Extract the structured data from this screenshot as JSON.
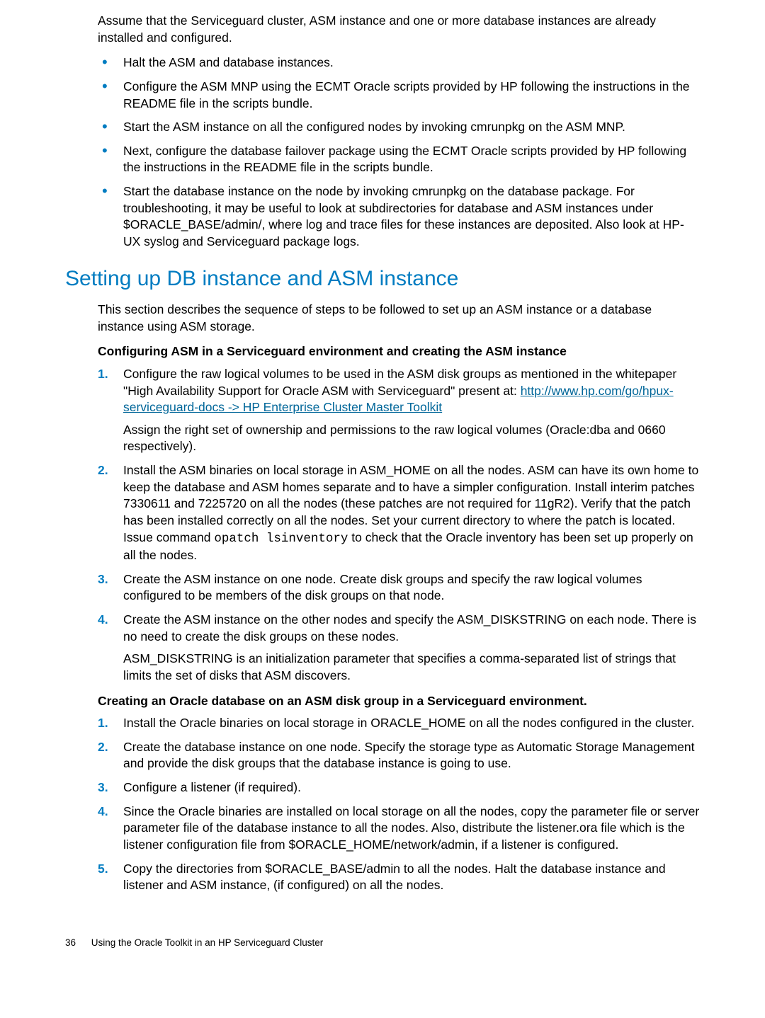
{
  "intro": "Assume that the Serviceguard cluster, ASM instance and one or more database instances are already installed and configured.",
  "bullets": [
    "Halt the ASM and database instances.",
    "Configure the ASM MNP using the ECMT Oracle scripts provided by HP following the instructions in the README file in the scripts bundle.",
    "Start the ASM instance on all the configured nodes by invoking cmrunpkg on the ASM MNP.",
    "Next, configure the database failover package using the ECMT Oracle scripts provided by HP following the instructions in the README file in the scripts bundle.",
    "Start the database instance on the node by invoking cmrunpkg on the database package. For troubleshooting, it may be useful to look at subdirectories for database and ASM instances under $ORACLE_BASE/admin/, where log and trace files for these instances are deposited. Also look at HP-UX syslog and Serviceguard package logs."
  ],
  "section_title": "Setting up DB instance and ASM instance",
  "section_intro": "This section describes the sequence of steps to be followed to set up an ASM instance or a database instance using ASM storage.",
  "sub1_title": "Configuring ASM in a Serviceguard environment and creating the ASM instance",
  "sub1_steps": {
    "s1_pre": "Configure the raw logical volumes to be used in the ASM disk groups as mentioned in the whitepaper \"High Availability Support for Oracle ASM with Serviceguard\" present at: ",
    "s1_link": "http://www.hp.com/go/hpux-serviceguard-docs -> HP Enterprise Cluster Master Toolkit",
    "s1_after": "Assign the right set of ownership and permissions to the raw logical volumes (Oracle:dba and 0660 respectively).",
    "s2_pre": "Install the ASM binaries on local storage in ASM_HOME on all the nodes. ASM can have its own home to keep the database and ASM homes separate and to have a simpler configuration. Install interim patches 7330611 and 7225720 on all the nodes (these patches are not required for 11gR2). Verify that the patch has been installed correctly on all the nodes. Set your current directory to where the patch is located. Issue command ",
    "s2_code": "opatch lsinventory",
    "s2_post": " to check that the Oracle inventory has been set up properly on all the nodes.",
    "s3": "Create the ASM instance on one node. Create disk groups and specify the raw logical volumes configured to be members of the disk groups on that node.",
    "s4": "Create the ASM instance on the other nodes and specify the ASM_DISKSTRING on each node. There is no need to create the disk groups on these nodes.",
    "s4_after": "ASM_DISKSTRING is an initialization parameter that specifies a comma-separated list of strings that limits the set of disks that ASM discovers."
  },
  "sub2_title": "Creating an Oracle database on an ASM disk group in a Serviceguard environment.",
  "sub2_steps": {
    "s1": "Install the Oracle binaries on local storage in ORACLE_HOME on all the nodes configured in the cluster.",
    "s2": "Create the database instance on one node. Specify the storage type as Automatic Storage Management and provide the disk groups that the database instance is going to use.",
    "s3": "Configure a listener (if required).",
    "s4": "Since the Oracle binaries are installed on local storage on all the nodes, copy the parameter file or server parameter file of the database instance to all the nodes. Also, distribute the listener.ora file which is the listener configuration file from $ORACLE_HOME/network/admin, if a listener is configured.",
    "s5": "Copy the directories from $ORACLE_BASE/admin to all the nodes. Halt the database instance and listener and ASM instance, (if configured) on all the nodes."
  },
  "nums": {
    "n1": "1.",
    "n2": "2.",
    "n3": "3.",
    "n4": "4.",
    "n5": "5."
  },
  "footer": {
    "page": "36",
    "title": "Using the Oracle Toolkit in an HP Serviceguard Cluster"
  }
}
